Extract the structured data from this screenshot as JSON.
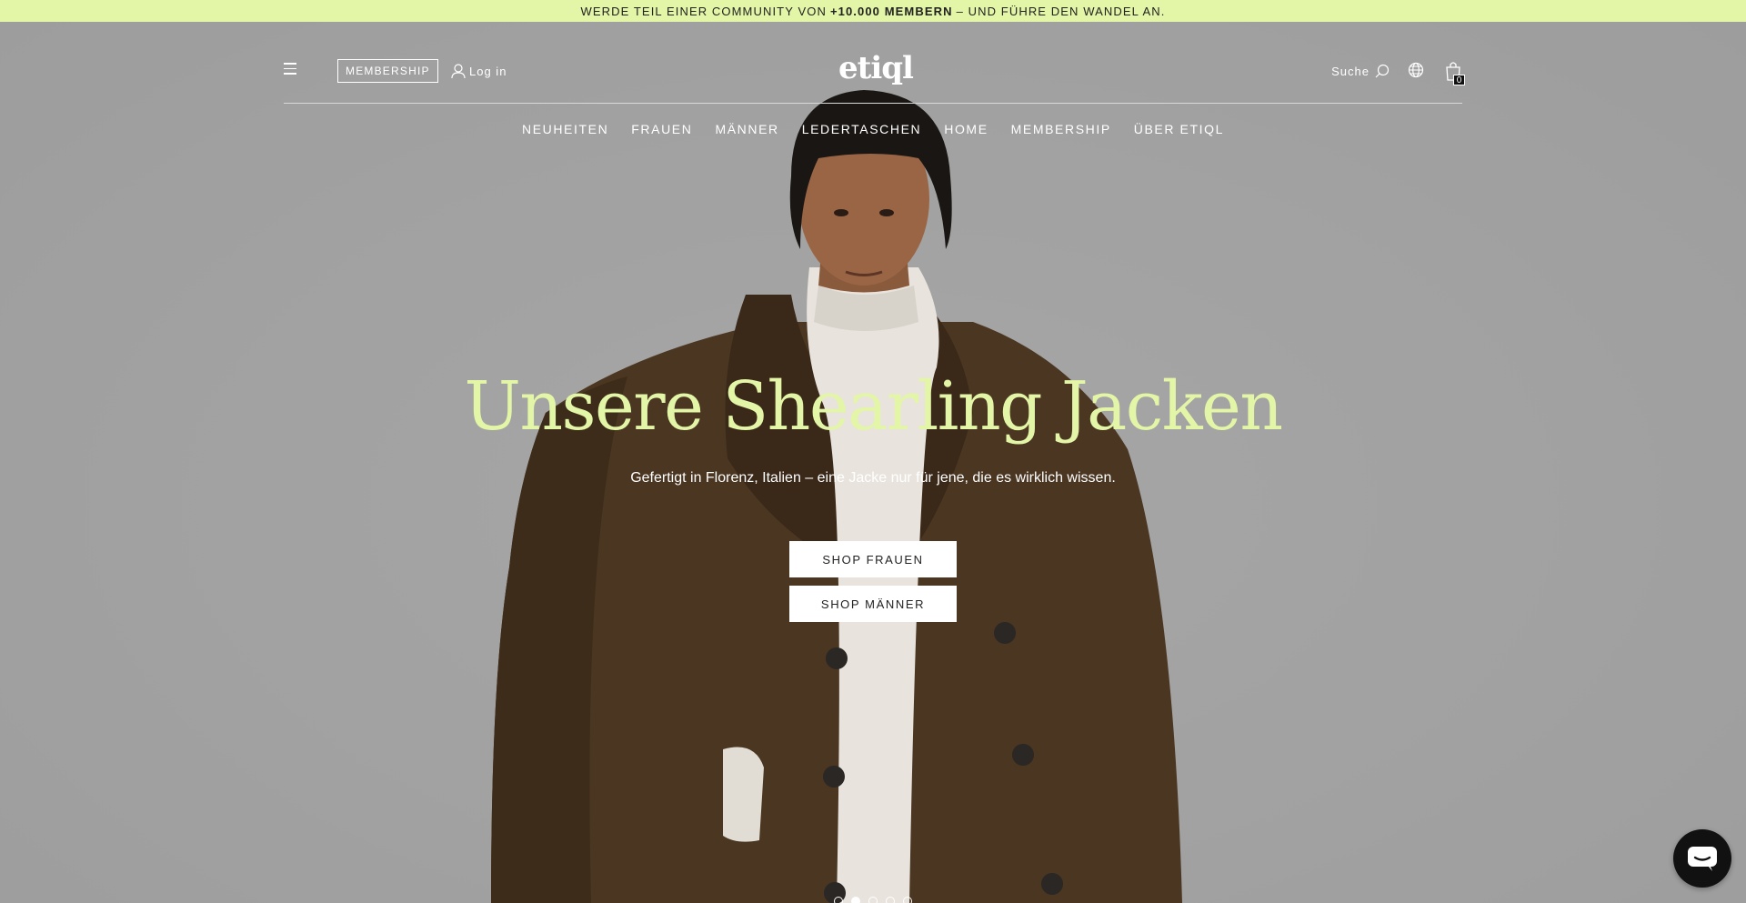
{
  "announcement": {
    "prefix": "WERDE TEIL EINER COMMUNITY VON",
    "highlight": "+10.000 MEMBERN",
    "suffix": "– UND FÜHRE DEN WANDEL AN."
  },
  "header": {
    "membership_label": "MEMBERSHIP",
    "login_label": "Log in",
    "logo": "etiql",
    "search_label": "Suche",
    "cart_count": "0"
  },
  "nav": {
    "items": [
      "NEUHEITEN",
      "FRAUEN",
      "MÄNNER",
      "LEDERTASCHEN",
      "HOME",
      "MEMBERSHIP",
      "ÜBER ETIQL"
    ]
  },
  "hero": {
    "headline": "Unsere Shearling Jacken",
    "subline": "Gefertigt in Florenz, Italien – eine Jacke nur für jene, die es wirklich wissen.",
    "cta_women": "SHOP FRAUEN",
    "cta_men": "SHOP MÄNNER",
    "slides_total": 5,
    "slide_active": 2
  },
  "icons": {
    "menu": "hamburger-icon",
    "user": "user-icon",
    "search": "search-icon",
    "globe": "globe-icon",
    "cart": "shopping-bag-icon",
    "chat": "chat-icon"
  },
  "colors": {
    "accent": "#e3f5a6",
    "hero_bg": "#a3a3a3",
    "jacket": "#4a3621",
    "button_bg": "#ffffff",
    "chat_bg": "#111111"
  }
}
